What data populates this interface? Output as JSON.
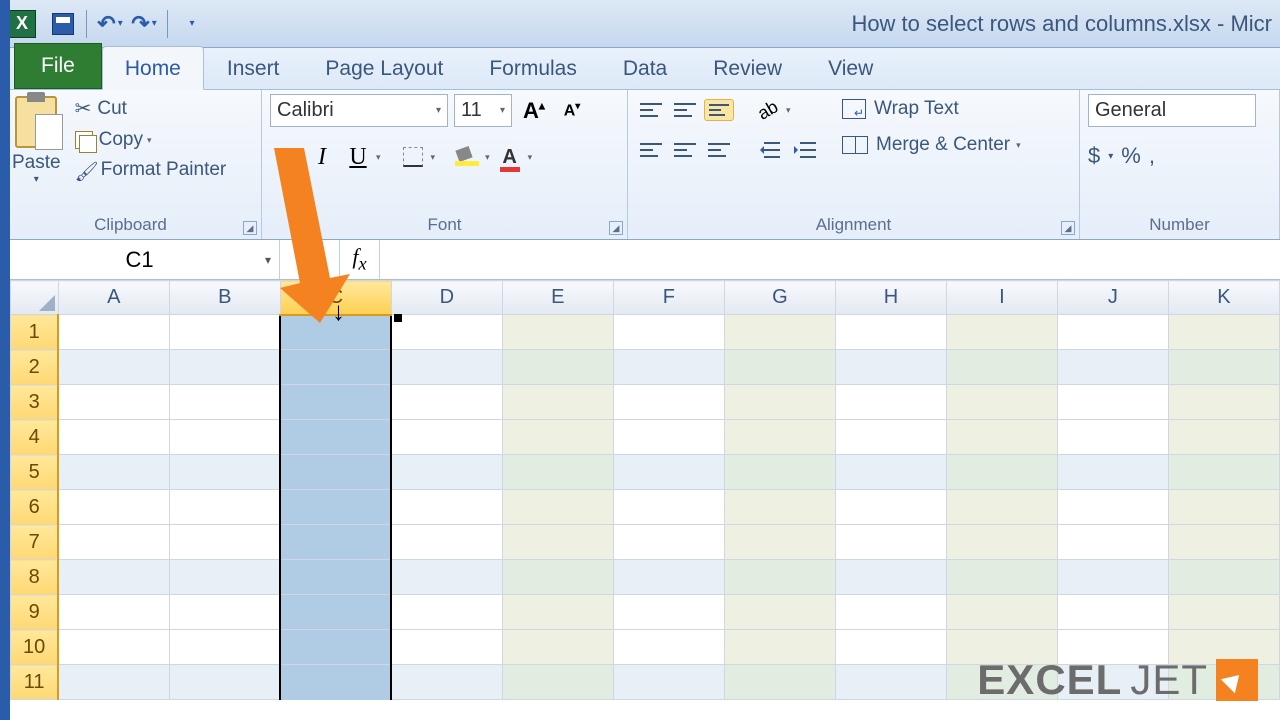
{
  "window_title": "How to select rows and columns.xlsx - Micr",
  "tabs": {
    "file": "File",
    "home": "Home",
    "insert": "Insert",
    "page_layout": "Page Layout",
    "formulas": "Formulas",
    "data": "Data",
    "review": "Review",
    "view": "View"
  },
  "clipboard": {
    "group": "Clipboard",
    "paste": "Paste",
    "cut": "Cut",
    "copy": "Copy",
    "format_painter": "Format Painter"
  },
  "font": {
    "group": "Font",
    "name": "Calibri",
    "size": "11"
  },
  "alignment": {
    "group": "Alignment",
    "wrap": "Wrap Text",
    "merge": "Merge & Center"
  },
  "number": {
    "group": "Number",
    "format": "General",
    "currency": "$",
    "percent": "%",
    "comma": ","
  },
  "name_box": "C1",
  "columns": [
    "A",
    "B",
    "C",
    "D",
    "E",
    "F",
    "G",
    "H",
    "I",
    "J",
    "K"
  ],
  "rows": [
    "1",
    "2",
    "3",
    "4",
    "5",
    "6",
    "7",
    "8",
    "9",
    "10",
    "11"
  ],
  "selected_col_index": 2,
  "banded_cols": [
    4,
    6,
    8,
    10
  ],
  "watermark_a": "EXCEL",
  "watermark_b": "JET"
}
